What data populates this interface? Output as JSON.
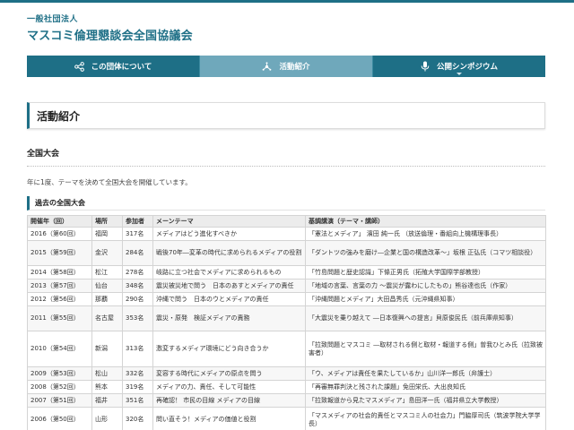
{
  "header": {
    "org_type": "一般社団法人",
    "org_name": "マスコミ倫理懇談会全国協議会"
  },
  "nav": {
    "items": [
      {
        "label": "この団体について",
        "icon": "share-network-icon",
        "active": false
      },
      {
        "label": "活動紹介",
        "icon": "node-hub-icon",
        "active": true
      },
      {
        "label": "公開シンポジウム",
        "icon": "microphone-icon",
        "active": false
      }
    ]
  },
  "page": {
    "title": "活動紹介",
    "section_title": "全国大会",
    "intro": "年に1度、テーマを決めて全国大会を開催しています。",
    "subsection_title": "過去の全国大会"
  },
  "table": {
    "headers": [
      "開催年（回）",
      "場所",
      "参加者",
      "メーンテーマ",
      "基調講演（テーマ・講師）"
    ],
    "rows": [
      {
        "year": "2016（第60回）",
        "place": "福岡",
        "participants": "317名",
        "theme": "メディアはどう進化すべきか",
        "keynote": "「憲法とメディア」 濱田 純一氏 （放送倫理・番組向上機構理事長）"
      },
      {
        "year": "2015（第59回）",
        "place": "金沢",
        "participants": "284名",
        "theme": "戦後70年―変革の時代に求められるメディアの役割",
        "keynote": "「ダントツの強みを磨け―企業と国の構造改革～」坂根 正弘氏（コマツ相談役）"
      },
      {
        "year": "2014（第58回）",
        "place": "松江",
        "participants": "278名",
        "theme": "岐路に立つ社会でメディアに求められるもの",
        "keynote": "「竹島問題と歴史認識」下條正男氏（拓殖大学国際学部教授）"
      },
      {
        "year": "2013（第57回）",
        "place": "仙台",
        "participants": "348名",
        "theme": "震災被災地で問う　日本のあすとメディアの責任",
        "keynote": "「地域の言葉、言葉の力 ～震災が露わにしたもの」熊谷達也氏（作家）"
      },
      {
        "year": "2012（第56回）",
        "place": "那覇",
        "participants": "290名",
        "theme": "沖縄で問う　日本のウとメディアの責任",
        "keynote": "「沖縄問題とメディア」大田昌秀氏（元沖縄県知事）"
      },
      {
        "year": "2011（第55回）",
        "place": "名古屋",
        "participants": "353名",
        "theme": "震災・原発　検証メディアの責務",
        "keynote": "「大震災を乗り越えて ―日本復興への提言」貝原俊民氏（前兵庫県知事）"
      },
      {
        "year": "2010（第54回）",
        "place": "新潟",
        "participants": "313名",
        "theme": "激変するメディア環境にどう向き合うか",
        "keynote": "「拉致問題とマスコミ ―取材される側と取材・報道する側」曽我ひとみ氏（拉致被害者）"
      },
      {
        "year": "2009（第53回）",
        "place": "松山",
        "participants": "332名",
        "theme": "変容する時代にメディアの原点を問う",
        "keynote": "「ウ、メディアは責任を果たしているか」山川洋一郎氏（弁護士）"
      },
      {
        "year": "2008（第52回）",
        "place": "熊本",
        "participants": "319名",
        "theme": "メディアの力、責任、そして可能性",
        "keynote": "「再審無罪判決と残された課題」免田栄氏、大出良知氏"
      },
      {
        "year": "2007（第51回）",
        "place": "福井",
        "participants": "351名",
        "theme": "再確認！ 市民の目線 メディアの目線",
        "keynote": "「拉致報道から見たマスメディア」島田洋一氏（福井県立大学教授）"
      },
      {
        "year": "2006（第50回）",
        "place": "山形",
        "participants": "320名",
        "theme": "問い直そう！メディアの価値と役割",
        "keynote": "「マスメディアの社会的責任とマスコミ人の社会力」門脇厚司氏（筑波学院大学学長）"
      }
    ]
  },
  "colors": {
    "brand": "#1e6f86",
    "nav_active": "#6fa8bb",
    "header_row": "#ececec"
  }
}
